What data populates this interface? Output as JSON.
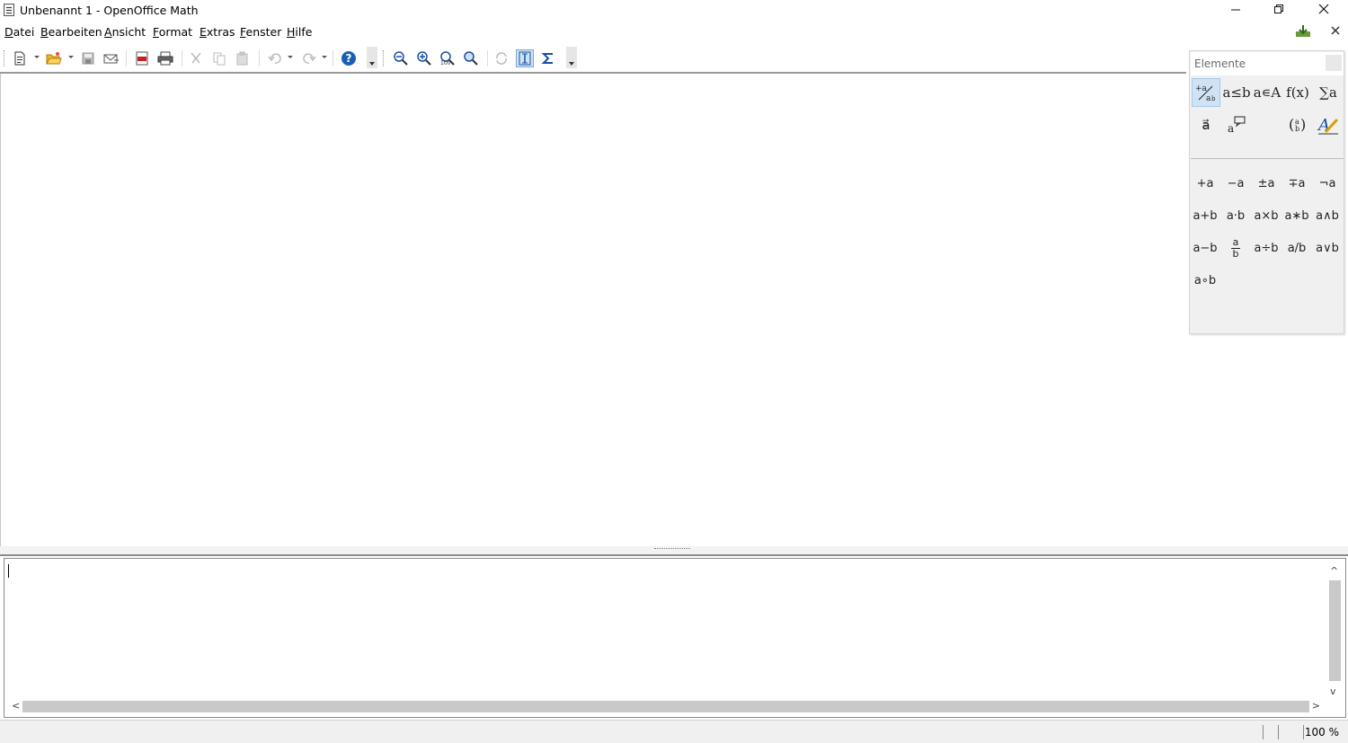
{
  "window": {
    "title": "Unbenannt 1 - OpenOffice Math",
    "minimize_icon": "minimize-icon",
    "restore_icon": "restore-icon",
    "close_icon": "close-icon"
  },
  "menubar": {
    "items": [
      {
        "label_ul": "D",
        "label_rest": "atei"
      },
      {
        "label_ul": "B",
        "label_rest": "earbeiten"
      },
      {
        "label_ul": "A",
        "label_rest": "nsicht"
      },
      {
        "label_ul": "F",
        "label_rest": "ormat"
      },
      {
        "label_ul": "E",
        "label_rest": "xtras"
      },
      {
        "label_ul": "F",
        "label_rest": "enster"
      },
      {
        "label_ul": "H",
        "label_rest": "ilfe"
      }
    ]
  },
  "toolbar": {
    "icons": [
      "new-document-icon",
      "open-folder-icon",
      "save-icon",
      "email-icon",
      "export-pdf-icon",
      "print-icon",
      "cut-icon",
      "copy-icon",
      "paste-icon",
      "undo-icon",
      "redo-icon",
      "help-icon",
      "zoom-out-icon",
      "zoom-in-icon",
      "zoom-100-icon",
      "show-all-icon",
      "update-icon",
      "formula-cursor-icon",
      "symbols-icon"
    ]
  },
  "elements_panel": {
    "title": "Elemente",
    "categories_row1": [
      "+a/b",
      "a≤b",
      "a∊A",
      "f(x)",
      "∑a"
    ],
    "categories_row2": [
      "a⃗",
      "a💬",
      "(a b)",
      "A✎"
    ],
    "symbols": {
      "row1": [
        "+a",
        "−a",
        "±a",
        "∓a",
        "¬a"
      ],
      "row2": [
        "a+b",
        "a·b",
        "a×b",
        "a∗b",
        "a∧b"
      ],
      "row3": [
        "a−b",
        "a/b frac",
        "a÷b",
        "a/b",
        "a∨b"
      ],
      "row4": [
        "a∘b"
      ]
    },
    "frac_num": "a",
    "frac_den": "b"
  },
  "statusbar": {
    "zoom": "100 %"
  }
}
